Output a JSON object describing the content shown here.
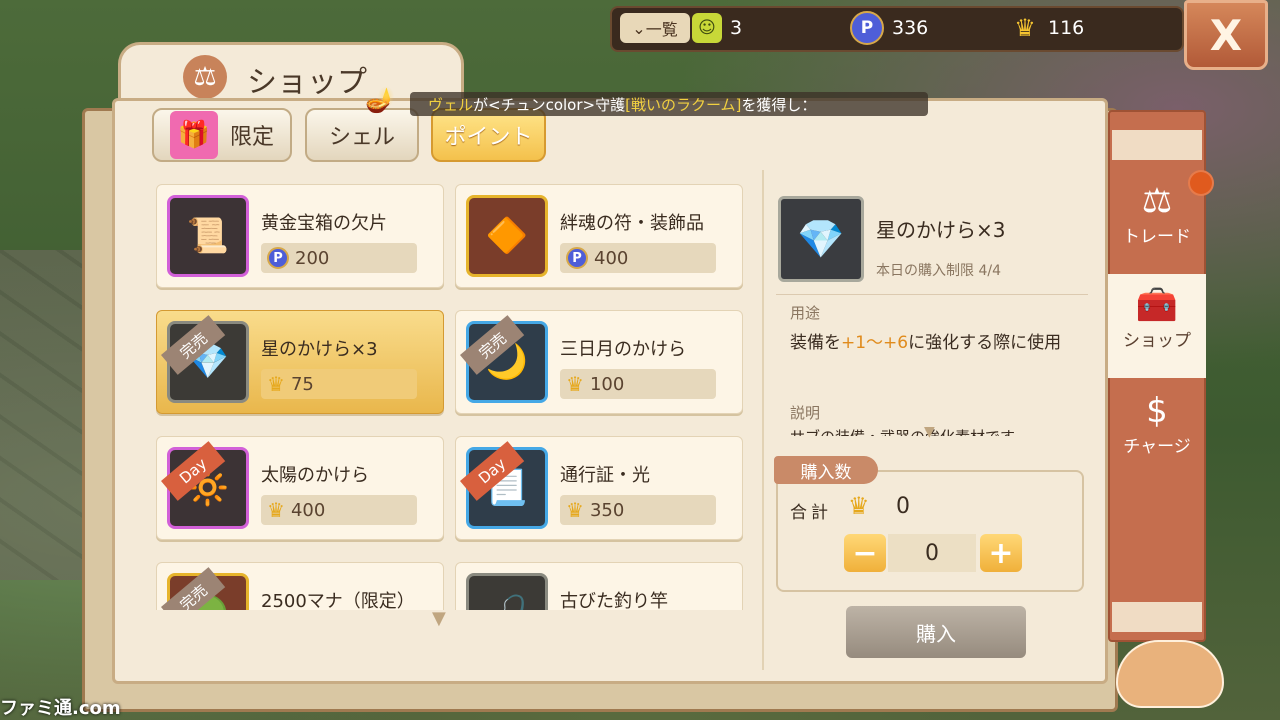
{
  "top_bar": {
    "list_label": "一覧",
    "ticket": {
      "value": "3",
      "icon": "ticket-icon"
    },
    "points": {
      "value": "336",
      "icon": "p-coin-icon"
    },
    "crowns": {
      "value": "116",
      "icon": "crown-icon"
    },
    "close_label": "X"
  },
  "shop_title": "ショップ",
  "tabs": [
    {
      "label": "限定",
      "active": false
    },
    {
      "label": "シェル",
      "active": false
    },
    {
      "label": "ポイント",
      "active": true
    }
  ],
  "notice": {
    "part1": "ヴェル",
    "part2": "が<チュンcolor>守護",
    "part3": "[戦いのラクーム]",
    "part4": "を獲得し："
  },
  "items": [
    {
      "name": "黄金宝箱の欠片",
      "price": "200",
      "currency": "point",
      "ribbon": "",
      "frame": "purple",
      "icon": "gold-chest-shard-icon"
    },
    {
      "name": "絆魂の符・装飾品",
      "price": "400",
      "currency": "point",
      "ribbon": "",
      "frame": "gold",
      "icon": "soul-charm-icon"
    },
    {
      "name": "星のかけら×3",
      "price": "75",
      "currency": "crown",
      "ribbon": "完売",
      "frame": "gray",
      "icon": "star-shard-icon"
    },
    {
      "name": "三日月のかけら",
      "price": "100",
      "currency": "crown",
      "ribbon": "完売",
      "frame": "blue",
      "icon": "crescent-shard-icon"
    },
    {
      "name": "太陽のかけら",
      "price": "400",
      "currency": "crown",
      "ribbon": "Day",
      "frame": "purple",
      "icon": "sun-shard-icon"
    },
    {
      "name": "通行証・光",
      "price": "350",
      "currency": "crown",
      "ribbon": "Day",
      "frame": "blue",
      "icon": "pass-scroll-icon"
    },
    {
      "name": "2500マナ（限定）",
      "price": "",
      "currency": "",
      "ribbon": "完売",
      "frame": "gold",
      "icon": "mana-crystal-icon"
    },
    {
      "name": "古びた釣り竿",
      "price": "",
      "currency": "",
      "ribbon": "",
      "frame": "gray",
      "icon": "fishing-rod-icon"
    }
  ],
  "detail": {
    "name": "星のかけら×3",
    "limit": "本日の購入制限 4/4",
    "usage_label": "用途",
    "usage_pre": "装備を",
    "usage_range": "+1～+6",
    "usage_post": "に強化する際に使用",
    "desc_label": "説明",
    "desc_text": "サブの装備・武器の強化素材です"
  },
  "purchase": {
    "qty_label": "購入数",
    "total_label": "合計",
    "total_value": "0",
    "quantity": "0",
    "minus": "−",
    "plus": "+",
    "buy_label": "購入"
  },
  "sidebar": [
    {
      "label": "トレード",
      "icon": "scale-icon",
      "active": false
    },
    {
      "label": "ショップ",
      "icon": "chest-icon",
      "active": true
    },
    {
      "label": "チャージ",
      "icon": "dollar-icon",
      "active": false
    }
  ],
  "watermark": "ファミ通.com"
}
